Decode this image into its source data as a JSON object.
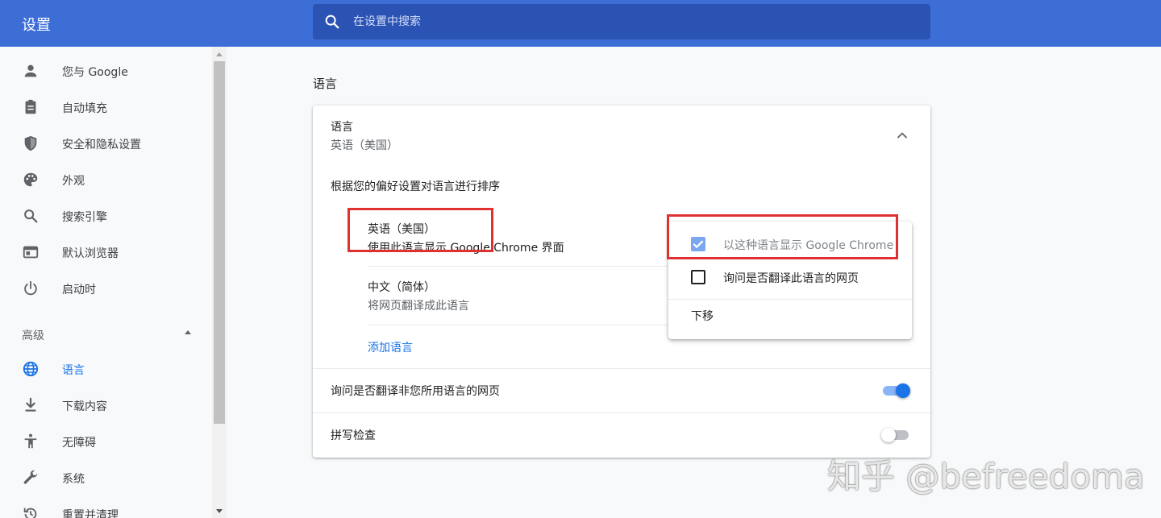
{
  "app": {
    "title": "设置"
  },
  "search": {
    "placeholder": "在设置中搜索"
  },
  "sidebar": {
    "items": [
      {
        "label": "您与 Google",
        "icon": "person-icon"
      },
      {
        "label": "自动填充",
        "icon": "clipboard-icon"
      },
      {
        "label": "安全和隐私设置",
        "icon": "shield-icon"
      },
      {
        "label": "外观",
        "icon": "palette-icon"
      },
      {
        "label": "搜索引擎",
        "icon": "search-icon"
      },
      {
        "label": "默认浏览器",
        "icon": "browser-icon"
      },
      {
        "label": "启动时",
        "icon": "power-icon"
      }
    ],
    "advanced_label": "高级",
    "advanced_items": [
      {
        "label": "语言",
        "icon": "globe-icon",
        "active": true
      },
      {
        "label": "下载内容",
        "icon": "download-icon"
      },
      {
        "label": "无障碍",
        "icon": "accessibility-icon"
      },
      {
        "label": "系统",
        "icon": "wrench-icon"
      },
      {
        "label": "重置并清理",
        "icon": "history-icon"
      }
    ]
  },
  "main": {
    "section_title": "语言",
    "card": {
      "title": "语言",
      "subtitle": "英语（美国）",
      "order_hint": "根据您的偏好设置对语言进行排序",
      "languages": [
        {
          "name": "英语（美国）",
          "desc": "使用此语言显示 Google Chrome 界面"
        },
        {
          "name": "中文（简体）",
          "desc": "将网页翻译成此语言"
        }
      ],
      "add_language": "添加语言",
      "translate_prompt": {
        "label": "询问是否翻译非您所用语言的网页",
        "enabled": true
      },
      "spellcheck": {
        "label": "拼写检查",
        "enabled": false
      }
    }
  },
  "menu": {
    "items": [
      {
        "label": "以这种语言显示 Google Chrome",
        "checked": true,
        "disabled": true
      },
      {
        "label": "询问是否翻译此语言的网页",
        "checked": false,
        "disabled": false
      }
    ],
    "move_down": "下移"
  },
  "colors": {
    "header": "#3c6ed6",
    "search_bg": "#2b53b4",
    "accent": "#1a73e8",
    "annotation": "#e03131"
  },
  "watermark": "知乎 @befreedoma"
}
